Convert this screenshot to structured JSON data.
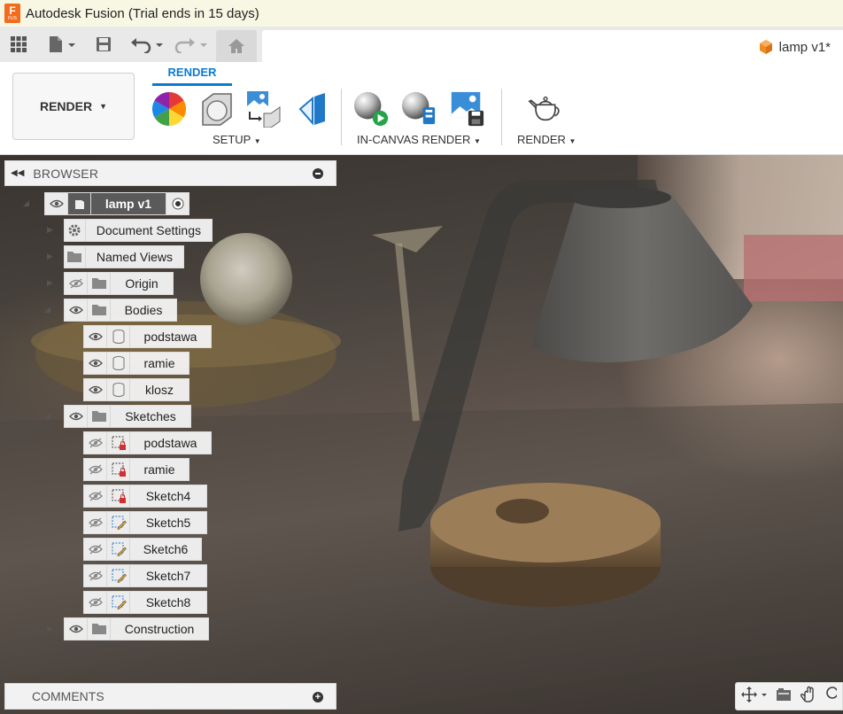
{
  "app": {
    "title": "Autodesk Fusion (Trial ends in 15 days)",
    "logo_letter": "F",
    "logo_sub": "FUS",
    "doc_tab": "lamp v1*"
  },
  "ribbon": {
    "workspace": "RENDER",
    "active_tab": "RENDER",
    "groups": {
      "setup": "SETUP",
      "in_canvas": "IN-CANVAS RENDER",
      "render": "RENDER"
    }
  },
  "browser": {
    "title": "BROWSER",
    "root": "lamp v1",
    "items": [
      {
        "label": "Document Settings"
      },
      {
        "label": "Named Views"
      },
      {
        "label": "Origin"
      },
      {
        "label": "Bodies"
      },
      {
        "label": "podstawa"
      },
      {
        "label": "ramie"
      },
      {
        "label": "klosz"
      },
      {
        "label": "Sketches"
      },
      {
        "label": "podstawa"
      },
      {
        "label": "ramie"
      },
      {
        "label": "Sketch4"
      },
      {
        "label": "Sketch5"
      },
      {
        "label": "Sketch6"
      },
      {
        "label": "Sketch7"
      },
      {
        "label": "Sketch8"
      },
      {
        "label": "Construction"
      }
    ]
  },
  "comments": {
    "title": "COMMENTS"
  },
  "colors": {
    "accent": "#0a7bcf",
    "logo": "#f26c1c",
    "titlebar": "#f7f7e4"
  }
}
